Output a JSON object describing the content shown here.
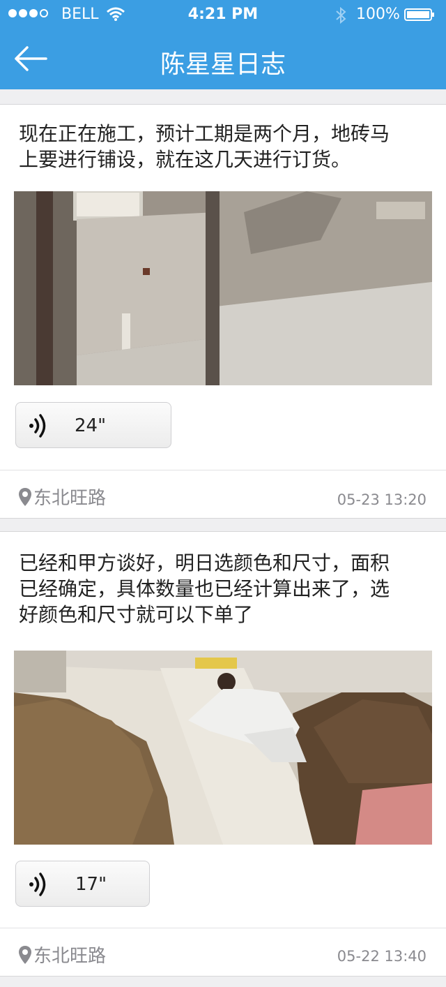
{
  "status_bar": {
    "carrier": "BELL",
    "time": "4:21 PM",
    "battery": "100%"
  },
  "nav": {
    "title": "陈星星日志"
  },
  "posts": [
    {
      "text": "现在正在施工，预计工期是两个月，地砖马\n上要进行铺设，就在这几天进行订货。",
      "voice_duration": "24\"",
      "location": "东北旺路",
      "time": "05-23 13:20"
    },
    {
      "text": "已经和甲方谈好，明日选颜色和尺寸，面积\n已经确定，具体数量也已经计算出来了，选\n好颜色和尺寸就可以下单了",
      "voice_duration": "17\"",
      "location": "东北旺路",
      "time": "05-22 13:40"
    }
  ],
  "colors": {
    "header": "#3b9ee3",
    "background": "#efeff1",
    "meta_text": "#8a8a8f"
  },
  "icons": [
    "wifi-icon",
    "bluetooth-icon",
    "battery-icon",
    "back-arrow-icon",
    "voice-icon",
    "location-pin-icon"
  ]
}
